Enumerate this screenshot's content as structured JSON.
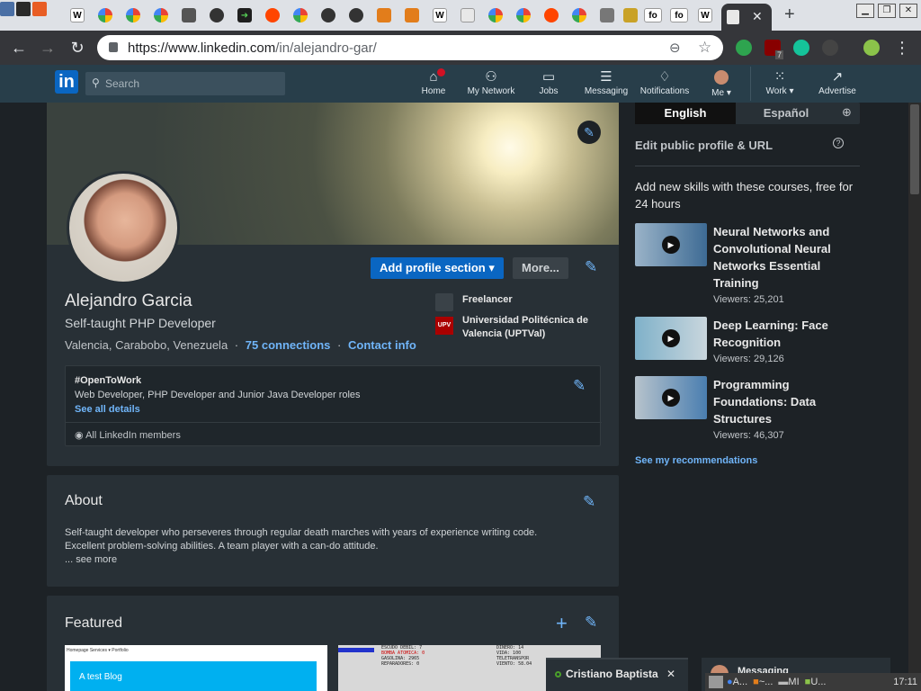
{
  "browser": {
    "url_host": "https://www.linkedin.com",
    "url_path": "/in/alejandro-gar/",
    "tab_icons": [
      "wikipedia",
      "google",
      "google",
      "google",
      "terminal",
      "github",
      "arrow",
      "reddit",
      "google",
      "github",
      "github",
      "sublime",
      "sublime",
      "wikipedia",
      "doc",
      "google",
      "google",
      "reddit",
      "google",
      "tool",
      "trophy",
      "fo",
      "fo",
      "wikipedia",
      "doc"
    ],
    "tab_labels": {
      "fo1": "fo",
      "fo2": "fo"
    },
    "close_tab": "✕",
    "new_tab": "+",
    "ext_badge": "7"
  },
  "nav": {
    "search_placeholder": "Search",
    "items": [
      {
        "label": "Home",
        "icon": "home-icon"
      },
      {
        "label": "My Network",
        "icon": "network-icon"
      },
      {
        "label": "Jobs",
        "icon": "briefcase-icon"
      },
      {
        "label": "Messaging",
        "icon": "message-icon"
      },
      {
        "label": "Notifications",
        "icon": "bell-icon"
      },
      {
        "label": "Me",
        "icon": "avatar"
      },
      {
        "label": "Work",
        "icon": "grid-icon"
      },
      {
        "label": "Advertise",
        "icon": "compass-icon"
      }
    ]
  },
  "profile": {
    "name": "Alejandro Garcia",
    "headline": "Self-taught PHP Developer",
    "location": "Valencia, Carabobo, Venezuela",
    "sep": "·",
    "connections": "75 connections",
    "contact": "Contact info",
    "add_section": "Add profile section",
    "more": "More...",
    "experience": [
      {
        "label": "Freelancer",
        "logo": ""
      },
      {
        "label": "Universidad Politécnica de Valencia (UPTVal)",
        "logo": "UPV"
      }
    ],
    "open_to_work": {
      "title": "#OpenToWork",
      "roles": "Web Developer, PHP Developer and Junior Java Developer roles",
      "details": "See all details",
      "visibility": "All LinkedIn members"
    }
  },
  "about": {
    "heading": "About",
    "text1": "Self-taught developer who perseveres through regular death marches with years of experience writing code.",
    "text2": "Excellent problem-solving abilities. A team player with a can-do attitude.",
    "more": "... see more"
  },
  "featured": {
    "heading": "Featured",
    "thumb1_nav": "Homepage   Services ▾   Portfolio",
    "thumb1_title": "A test Blog",
    "thumb2_lines": [
      "ESCUDO DEBIL: 7",
      "BOMBA ATOMICA: 0",
      "GASOLINA: 2965",
      "REPARADORES: 0",
      "DINERO: 14",
      "VIDA: 100",
      "TELETRANSPOR",
      "VIENTO: 58.04"
    ]
  },
  "rail": {
    "lang_en": "English",
    "lang_es": "Español",
    "edit_public": "Edit public profile & URL",
    "courses_heading": "Add new skills with these courses, free for 24 hours",
    "courses": [
      {
        "title": "Neural Networks and Convolutional Neural Networks Essential Training",
        "viewers": "Viewers: 25,201"
      },
      {
        "title": "Deep Learning: Face Recognition",
        "viewers": "Viewers: 29,126"
      },
      {
        "title": "Programming Foundations: Data Structures",
        "viewers": "Viewers: 46,307"
      }
    ],
    "see_recs": "See my recommendations"
  },
  "chat": {
    "name": "Cristiano Baptista",
    "close": "✕",
    "messaging": "Messaging"
  },
  "taskbar": {
    "items": [
      "A...",
      "~...",
      "MI",
      "U..."
    ],
    "clock": "17:11"
  }
}
